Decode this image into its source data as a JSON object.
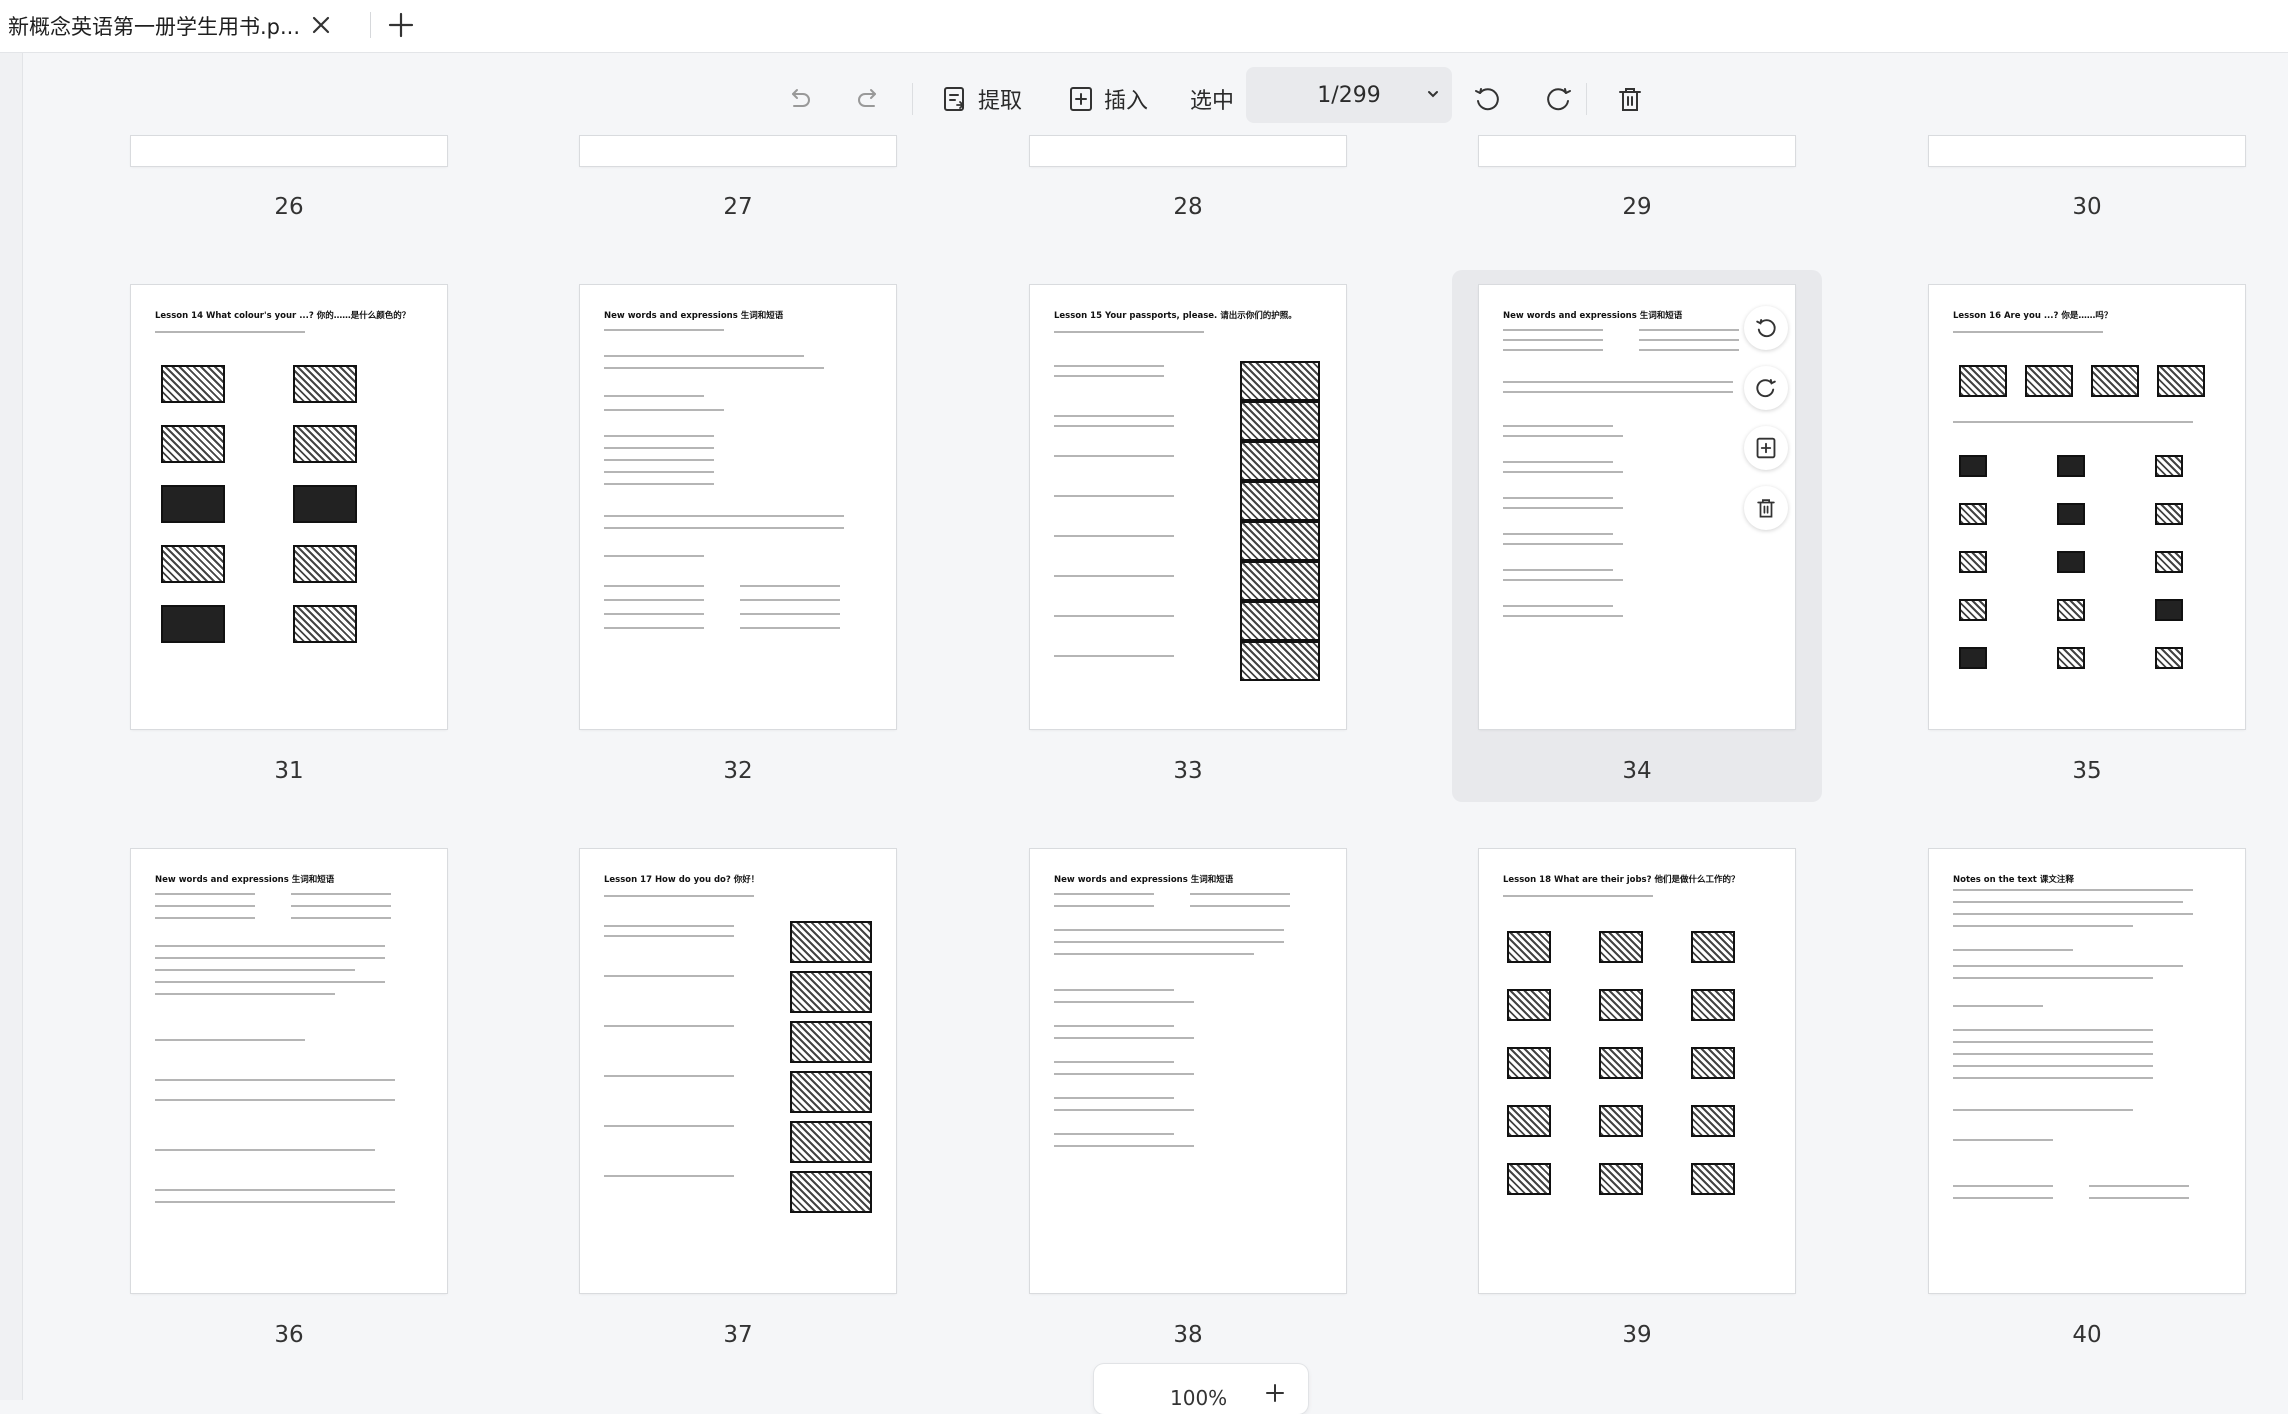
{
  "tab": {
    "title": "新概念英语第一册学生用书.p...",
    "close_icon": "close-icon",
    "add_icon": "plus-icon"
  },
  "toolbar": {
    "undo_icon": "undo-icon",
    "redo_icon": "redo-icon",
    "extract_label": "提取",
    "insert_label": "插入",
    "select_label": "选中",
    "page_indicator": "1/299",
    "rotate_left_icon": "rotate-left-icon",
    "rotate_right_icon": "rotate-right-icon",
    "delete_icon": "trash-icon"
  },
  "pages": {
    "row0": [
      "26",
      "27",
      "28",
      "29",
      "30"
    ],
    "row1": [
      "31",
      "32",
      "33",
      "34",
      "35"
    ],
    "row2": [
      "36",
      "37",
      "38",
      "39",
      "40"
    ],
    "selected": "34"
  },
  "thumb_titles": {
    "p31": "Lesson 14   What colour's your ...?  你的……是什么颜色的？",
    "p32": "New words and expressions  生词和短语",
    "p33": "Lesson 15   Your passports, please.  请出示你们的护照。",
    "p34": "New words and expressions  生词和短语",
    "p35": "Lesson 16   Are you ...?  你是……吗？",
    "p36": "New words and expressions  生词和短语",
    "p37": "Lesson 17   How do you do?  你好！",
    "p38": "New words and expressions  生词和短语",
    "p39": "Lesson 18   What are their jobs?  他们是做什么工作的？",
    "p40": "Notes on the text  课文注释"
  },
  "zoom": {
    "value": "100%"
  },
  "colors": {
    "selected_bg": "#e8e9ec",
    "background": "#f5f6f8"
  }
}
